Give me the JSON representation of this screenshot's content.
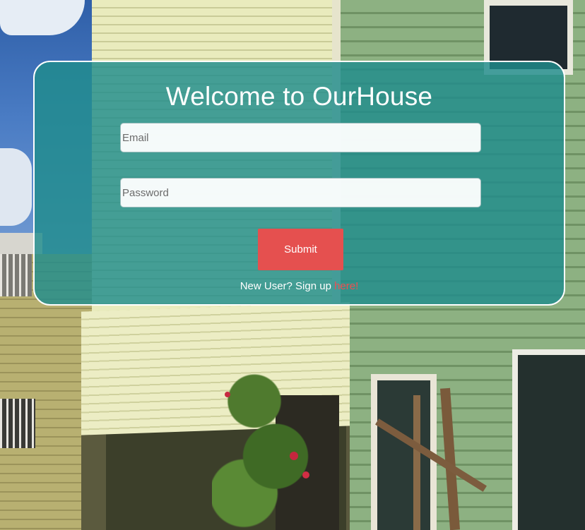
{
  "login": {
    "title_prefix": "Welcome to ",
    "title_brand": "OurHouse",
    "email_placeholder": "Email",
    "password_placeholder": "Password",
    "submit_label": "Submit",
    "signup_text": "New User? Sign up ",
    "signup_link": "here!"
  },
  "colors": {
    "card_bg": "#208c8c",
    "submit_bg": "#e5504f",
    "link": "#ee4f50"
  }
}
